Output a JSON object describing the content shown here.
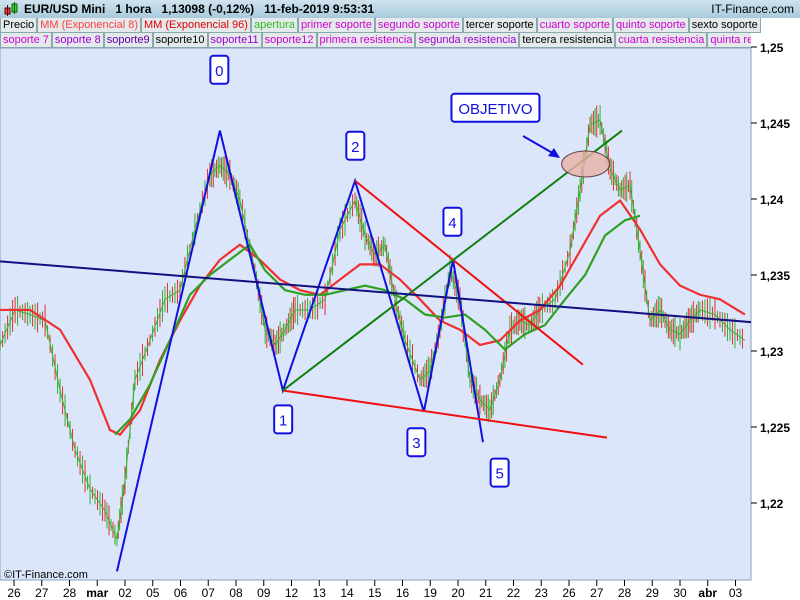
{
  "header": {
    "instrument": "EUR/USD Mini",
    "timeframe": "1 hora",
    "last": "1,13098 (-0,12%)",
    "datetime": "11-feb-2019 9:53:31",
    "site": "IT-Finance.com"
  },
  "legend_row1": [
    {
      "label": "Precio",
      "color": "#000000"
    },
    {
      "label": "MM (Exponencial 8)",
      "color": "#ff4040"
    },
    {
      "label": "MM (Exponencial 96)",
      "color": "#e00000"
    },
    {
      "label": "apertura",
      "color": "#30c020"
    },
    {
      "label": "primer soporte",
      "color": "#d000d0"
    },
    {
      "label": "segundo soporte",
      "color": "#d000d0"
    },
    {
      "label": "tercer soporte",
      "color": "#000000"
    },
    {
      "label": "cuarto soporte",
      "color": "#d000d0"
    },
    {
      "label": "quinto soporte",
      "color": "#d000d0"
    },
    {
      "label": "sexto soporte",
      "color": "#000000"
    }
  ],
  "legend_row2": [
    {
      "label": "soporte 7",
      "color": "#d000d0"
    },
    {
      "label": "soporte 8",
      "color": "#a000d0"
    },
    {
      "label": "soporte9",
      "color": "#6000a0"
    },
    {
      "label": "soporte10",
      "color": "#000000"
    },
    {
      "label": "soporte11",
      "color": "#a000d0"
    },
    {
      "label": "soporte12",
      "color": "#d000d0"
    },
    {
      "label": "primera resistencia",
      "color": "#d000d0"
    },
    {
      "label": "segunda resistencia",
      "color": "#a000d0"
    },
    {
      "label": "tercera resistencia",
      "color": "#000000"
    },
    {
      "label": "cuarta resistencia",
      "color": "#d000d0"
    },
    {
      "label": "quinta resistencia",
      "color": "#d000d0"
    }
  ],
  "copyright": "©IT-Finance.com",
  "chart_data": {
    "type": "line",
    "title": "EUR/USD Mini 1 hora",
    "ylim": [
      1.2145,
      1.25
    ],
    "yticks": [
      {
        "v": 1.25,
        "label": "1,25"
      },
      {
        "v": 1.245,
        "label": "1,245"
      },
      {
        "v": 1.24,
        "label": "1,24"
      },
      {
        "v": 1.235,
        "label": "1,235"
      },
      {
        "v": 1.23,
        "label": "1,23"
      },
      {
        "v": 1.225,
        "label": "1,225"
      },
      {
        "v": 1.22,
        "label": "1,22"
      }
    ],
    "xticks": [
      "26",
      "27",
      "28",
      "mar",
      "02",
      "05",
      "06",
      "07",
      "08",
      "09",
      "12",
      "13",
      "14",
      "15",
      "16",
      "19",
      "20",
      "21",
      "22",
      "23",
      "26",
      "27",
      "28",
      "29",
      "30",
      "abr",
      "03"
    ],
    "bold_xticks": [
      "mar",
      "abr"
    ],
    "series": [
      {
        "name": "Precio",
        "color": "#3cb030",
        "x": [
          -0.5,
          0.04,
          0.58,
          1.12,
          1.66,
          2.2,
          2.74,
          3.28,
          3.71,
          4.0,
          4.36,
          4.9,
          5.44,
          5.98,
          6.52,
          7.06,
          7.42,
          7.78,
          8.14,
          8.68,
          9.05,
          9.41,
          9.77,
          10.13,
          10.67,
          11.21,
          11.75,
          12.29,
          12.65,
          13.01,
          13.37,
          13.73,
          14.09,
          14.63,
          14.99,
          15.35,
          15.71,
          16.07,
          16.43,
          16.79,
          17.15,
          17.51,
          17.87,
          18.23,
          18.59,
          18.95,
          19.5,
          20.04,
          20.4,
          20.76,
          21.12,
          21.48,
          21.84,
          22.2,
          22.56,
          22.92,
          23.28,
          23.64,
          24.0,
          24.36,
          24.72,
          25.26,
          25.8,
          26.34
        ],
        "y": [
          1.2304,
          1.2327,
          1.2324,
          1.232,
          1.2274,
          1.2235,
          1.2209,
          1.2195,
          1.2176,
          1.2215,
          1.2281,
          1.2307,
          1.2334,
          1.234,
          1.238,
          1.2416,
          1.2422,
          1.2416,
          1.2399,
          1.2353,
          1.2314,
          1.2304,
          1.2314,
          1.2327,
          1.2327,
          1.2334,
          1.238,
          1.2399,
          1.2376,
          1.2363,
          1.237,
          1.2334,
          1.2307,
          1.2281,
          1.2287,
          1.2314,
          1.2353,
          1.2334,
          1.2281,
          1.2268,
          1.2261,
          1.2281,
          1.2314,
          1.232,
          1.2317,
          1.2327,
          1.2334,
          1.2366,
          1.2406,
          1.2449,
          1.2452,
          1.242,
          1.2406,
          1.2409,
          1.2366,
          1.232,
          1.2327,
          1.2314,
          1.2311,
          1.232,
          1.2327,
          1.2324,
          1.2314,
          1.2307
        ]
      },
      {
        "name": "MM (Exponencial 8)",
        "color": "#f03030",
        "x": [
          -0.5,
          0.58,
          1.66,
          2.74,
          3.46,
          3.82,
          4.54,
          5.26,
          5.98,
          6.7,
          7.42,
          8.14,
          8.86,
          9.59,
          10.31,
          11.03,
          11.75,
          12.47,
          13.19,
          13.91,
          14.63,
          15.35,
          16.07,
          16.79,
          17.51,
          18.23,
          18.95,
          19.68,
          20.4,
          21.12,
          21.84,
          22.56,
          23.28,
          24.0,
          24.72,
          25.44,
          26.34
        ],
        "y": [
          1.2327,
          1.2327,
          1.2314,
          1.2281,
          1.2248,
          1.2245,
          1.2261,
          1.2294,
          1.232,
          1.2343,
          1.236,
          1.237,
          1.236,
          1.2347,
          1.234,
          1.2337,
          1.2347,
          1.2357,
          1.2357,
          1.2347,
          1.2334,
          1.232,
          1.2314,
          1.2304,
          1.2307,
          1.232,
          1.2327,
          1.2343,
          1.2366,
          1.2389,
          1.2399,
          1.238,
          1.2357,
          1.2343,
          1.2337,
          1.2334,
          1.2324
        ]
      },
      {
        "name": "apertura",
        "color": "#30a020",
        "x": [
          3.64,
          4.18,
          4.9,
          5.62,
          6.34,
          7.06,
          7.78,
          8.5,
          9.05,
          9.77,
          10.49,
          11.21,
          11.93,
          12.65,
          13.37,
          14.09,
          14.81,
          15.53,
          16.25,
          16.97,
          17.69,
          18.41,
          19.13,
          19.86,
          20.58,
          21.3,
          22.02,
          22.56
        ],
        "y": [
          1.2245,
          1.2255,
          1.2278,
          1.2307,
          1.2337,
          1.235,
          1.236,
          1.237,
          1.2353,
          1.234,
          1.2337,
          1.2337,
          1.234,
          1.2343,
          1.234,
          1.2334,
          1.2324,
          1.2322,
          1.2324,
          1.2314,
          1.2301,
          1.2311,
          1.2317,
          1.2334,
          1.235,
          1.2376,
          1.2386,
          1.2389
        ]
      }
    ],
    "drawings": [
      {
        "name": "wave-line",
        "color": "#1010e0",
        "points": [
          [
            3.71,
            1.2155
          ],
          [
            7.42,
            1.2445
          ],
          [
            9.69,
            1.2274
          ],
          [
            12.29,
            1.2412
          ],
          [
            14.77,
            1.226
          ],
          [
            15.82,
            1.236
          ],
          [
            16.9,
            1.224
          ]
        ]
      },
      {
        "name": "resistance-line",
        "color": "#f01010",
        "points": [
          [
            12.29,
            1.2412
          ],
          [
            20.5,
            1.2291
          ]
        ]
      },
      {
        "name": "support-line",
        "color": "#f01010",
        "points": [
          [
            9.69,
            1.2274
          ],
          [
            21.37,
            1.2243
          ]
        ]
      },
      {
        "name": "target-line",
        "color": "#108010",
        "points": [
          [
            9.69,
            1.2274
          ],
          [
            21.91,
            1.2445
          ]
        ]
      },
      {
        "name": "trend-line",
        "color": "#101080",
        "points": [
          [
            -0.5,
            1.2359
          ],
          [
            26.56,
            1.2319
          ]
        ]
      }
    ],
    "annotations": [
      {
        "label": "0",
        "x": 7.4,
        "y": 1.2485
      },
      {
        "label": "1",
        "x": 9.7,
        "y": 1.2255
      },
      {
        "label": "2",
        "x": 12.3,
        "y": 1.2435
      },
      {
        "label": "3",
        "x": 14.5,
        "y": 1.224
      },
      {
        "label": "4",
        "x": 15.8,
        "y": 1.2385
      },
      {
        "label": "5",
        "x": 17.5,
        "y": 1.222
      },
      {
        "label": "OBJETIVO",
        "x": 17.35,
        "y": 1.246
      }
    ],
    "target_ellipse": {
      "x": 20.6,
      "y": 1.2423
    }
  }
}
